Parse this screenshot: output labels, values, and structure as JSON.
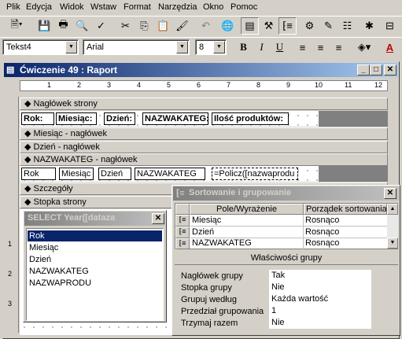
{
  "menu": [
    "Plik",
    "Edycja",
    "Widok",
    "Wstaw",
    "Format",
    "Narzędzia",
    "Okno",
    "Pomoc"
  ],
  "format_toolbar": {
    "object": "Tekst4",
    "font": "Arial",
    "size": "8",
    "bold": "B",
    "italic": "I",
    "underline": "U"
  },
  "window": {
    "title": "Ćwiczenie 49 : Raport"
  },
  "ruler": [
    "1",
    "2",
    "3",
    "4",
    "5",
    "6",
    "7",
    "8",
    "9",
    "10",
    "11",
    "12"
  ],
  "sections": {
    "page_header": "Nagłówek strony",
    "month_header": "Miesiąc - nagłówek",
    "day_header": "Dzień - nagłówek",
    "category_header": "NAZWAKATEG - nagłówek",
    "detail": "Szczegóły",
    "page_footer": "Stopka strony"
  },
  "page_header_labels": [
    "Rok:",
    "Miesiąc:",
    "Dzień:",
    "NAZWAKATEG:",
    "Ilość produktów:"
  ],
  "category_controls": [
    "Rok",
    "Miesiąc",
    "Dzień",
    "NAZWAKATEG",
    "=Policz([nazwaprodu"
  ],
  "fieldlist": {
    "title": "SELECT Year([dataza",
    "items": [
      "Rok",
      "Miesiąc",
      "Dzień",
      "NAZWAKATEG",
      "NAZWAPRODU"
    ]
  },
  "sorting": {
    "title": "Sortowanie i grupowanie",
    "col_field": "Pole/Wyrażenie",
    "col_order": "Porządek sortowania",
    "rows": [
      {
        "field": "Miesiąc",
        "order": "Rosnąco"
      },
      {
        "field": "Dzień",
        "order": "Rosnąco"
      },
      {
        "field": "NAZWAKATEG",
        "order": "Rosnąco"
      }
    ],
    "props_title": "Właściwości grupy",
    "props": [
      {
        "label": "Nagłówek grupy",
        "value": "Tak"
      },
      {
        "label": "Stopka grupy",
        "value": "Nie"
      },
      {
        "label": "Grupuj według",
        "value": "Każda wartość"
      },
      {
        "label": "Przedział grupowania",
        "value": "1"
      },
      {
        "label": "Trzymaj razem",
        "value": "Nie"
      }
    ]
  },
  "vruler": [
    "1",
    "2",
    "3"
  ]
}
